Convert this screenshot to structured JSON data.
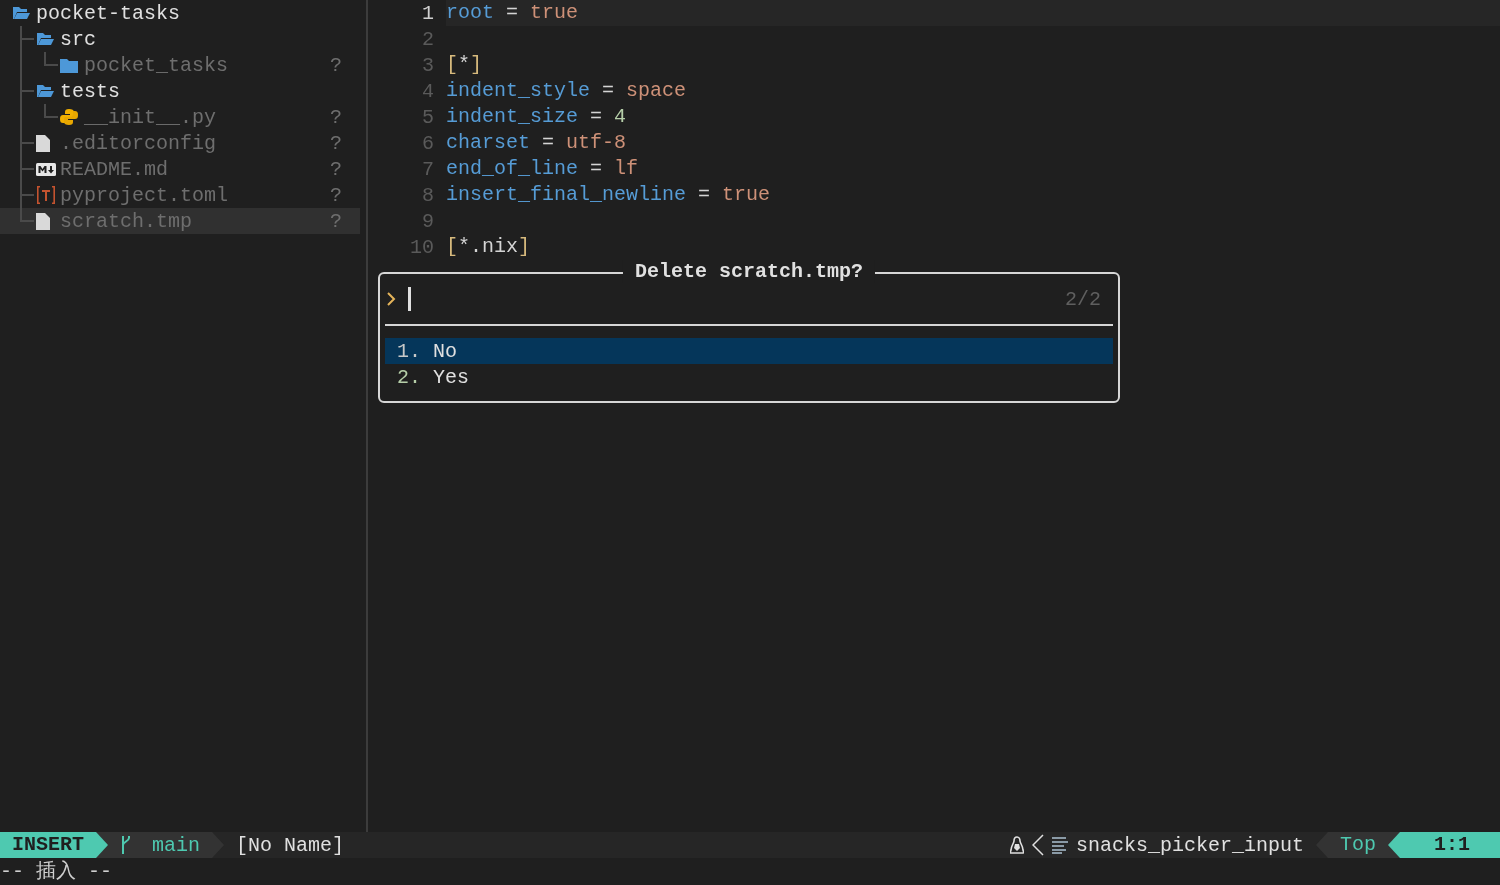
{
  "explorer": {
    "tree": {
      "name": "pocket-tasks",
      "kind": "folder",
      "expanded": true,
      "selected": false,
      "children": [
        {
          "name": "src",
          "kind": "folder",
          "expanded": true,
          "selected": false,
          "children": [
            {
              "name": "pocket_tasks",
              "kind": "folder",
              "expanded": false,
              "selected": false,
              "status": "?"
            }
          ]
        },
        {
          "name": "tests",
          "kind": "folder",
          "expanded": true,
          "selected": false,
          "children": [
            {
              "name": "__init__.py",
              "kind": "python",
              "selected": false,
              "status": "?"
            }
          ]
        },
        {
          "name": ".editorconfig",
          "kind": "file",
          "selected": false,
          "status": "?"
        },
        {
          "name": "README.md",
          "kind": "markdown",
          "selected": false,
          "status": "?"
        },
        {
          "name": "pyproject.toml",
          "kind": "toml",
          "selected": false,
          "status": "?"
        },
        {
          "name": "scratch.tmp",
          "kind": "file",
          "selected": true,
          "status": "?"
        }
      ]
    }
  },
  "editor": {
    "lines": [
      {
        "number": "1",
        "current": true,
        "tokens": [
          {
            "text": "root",
            "kind": "key"
          },
          {
            "text": " = ",
            "kind": "op"
          },
          {
            "text": "true",
            "kind": "string"
          }
        ]
      },
      {
        "number": "2",
        "current": false
      },
      {
        "number": "3",
        "current": false,
        "tokens": [
          {
            "text": "[",
            "kind": "bracket"
          },
          {
            "text": "*",
            "kind": "glob"
          },
          {
            "text": "]",
            "kind": "bracket"
          }
        ]
      },
      {
        "number": "4",
        "current": false,
        "tokens": [
          {
            "text": "indent_style",
            "kind": "key"
          },
          {
            "text": " = ",
            "kind": "op"
          },
          {
            "text": "space",
            "kind": "string"
          }
        ]
      },
      {
        "number": "5",
        "current": false,
        "tokens": [
          {
            "text": "indent_size",
            "kind": "key"
          },
          {
            "text": " = ",
            "kind": "op"
          },
          {
            "text": "4",
            "kind": "number"
          }
        ]
      },
      {
        "number": "6",
        "current": false,
        "tokens": [
          {
            "text": "charset",
            "kind": "key"
          },
          {
            "text": " = ",
            "kind": "op"
          },
          {
            "text": "utf-8",
            "kind": "string"
          }
        ]
      },
      {
        "number": "7",
        "current": false,
        "tokens": [
          {
            "text": "end_of_line",
            "kind": "key"
          },
          {
            "text": " = ",
            "kind": "op"
          },
          {
            "text": "lf",
            "kind": "string"
          }
        ]
      },
      {
        "number": "8",
        "current": false,
        "tokens": [
          {
            "text": "insert_final_newline",
            "kind": "key"
          },
          {
            "text": " = ",
            "kind": "op"
          },
          {
            "text": "true",
            "kind": "string"
          }
        ]
      },
      {
        "number": "9",
        "current": false
      },
      {
        "number": "10",
        "current": false,
        "tokens": [
          {
            "text": "[",
            "kind": "bracket"
          },
          {
            "text": "*.nix",
            "kind": "glob"
          },
          {
            "text": "]",
            "kind": "bracket"
          }
        ]
      }
    ]
  },
  "dialog": {
    "title": "Delete scratch.tmp?",
    "count": "2/2",
    "items": [
      {
        "number": "1.",
        "label": "No",
        "selected": true
      },
      {
        "number": "2.",
        "label": "Yes",
        "selected": false
      }
    ]
  },
  "status_line": {
    "mode": "INSERT",
    "branch": "main",
    "file": "[No Name]",
    "filetype": "snacks_picker_input",
    "position": "Top",
    "cursor": "1:1"
  },
  "cmdline": "-- 插入 --"
}
